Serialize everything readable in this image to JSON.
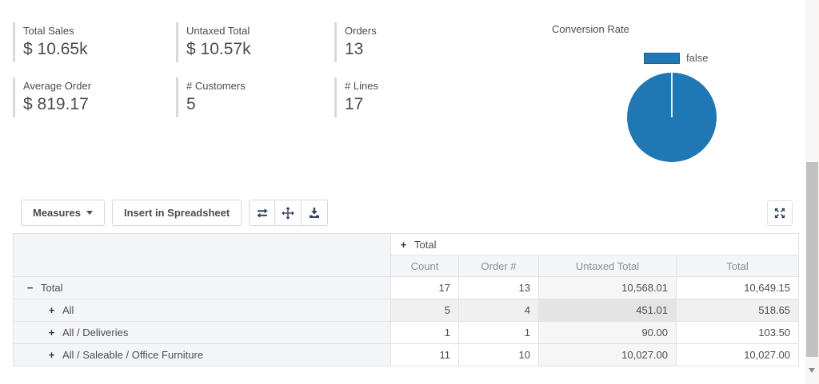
{
  "kpis": [
    {
      "label": "Total Sales",
      "value": "$ 10.65k"
    },
    {
      "label": "Untaxed Total",
      "value": "$ 10.57k"
    },
    {
      "label": "Orders",
      "value": "13"
    },
    {
      "label": "Average Order",
      "value": "$ 819.17"
    },
    {
      "label": "# Customers",
      "value": "5"
    },
    {
      "label": "# Lines",
      "value": "17"
    }
  ],
  "chart_data": {
    "type": "pie",
    "title": "Conversion Rate",
    "labels": [
      "false"
    ],
    "values": [
      100
    ],
    "colors": [
      "#1f77b4"
    ],
    "legend_position": "top",
    "legend": [
      {
        "label": "false",
        "color": "#1f77b4"
      }
    ]
  },
  "toolbar": {
    "measures_label": "Measures",
    "insert_label": "Insert in Spreadsheet",
    "icon_buttons": [
      "flip-axis-icon",
      "expand-all-icon",
      "download-icon"
    ],
    "fullscreen_icon": "fullscreen-arrows-icon"
  },
  "pivot": {
    "col_group": {
      "toggle": "+",
      "label": "Total"
    },
    "measures": [
      "Count",
      "Order #",
      "Untaxed Total",
      "Total"
    ],
    "rows": [
      {
        "toggle": "−",
        "indent": 0,
        "label": "Total",
        "values": [
          "17",
          "13",
          "10,568.01",
          "10,649.15"
        ],
        "highlight": false
      },
      {
        "toggle": "+",
        "indent": 1,
        "label": "All",
        "values": [
          "5",
          "4",
          "451.01",
          "518.65"
        ],
        "highlight": true
      },
      {
        "toggle": "+",
        "indent": 1,
        "label": "All / Deliveries",
        "values": [
          "1",
          "1",
          "90.00",
          "103.50"
        ],
        "highlight": false
      },
      {
        "toggle": "+",
        "indent": 1,
        "label": "All / Saleable / Office Furniture",
        "values": [
          "11",
          "10",
          "10,027.00",
          "10,027.00"
        ],
        "highlight": false
      }
    ]
  },
  "colors": {
    "accent_blue": "#1f77b4",
    "text_dark": "#4c4c4c",
    "header_text_gray": "#8f8f8f",
    "header_bg": "#f4f5f8",
    "row_highlight_bg": "#f0f0f0",
    "column_tint_bg": "#f6f6f6",
    "intersection_bg": "#e4e4e4",
    "border": "#e2e2e2",
    "icon_dark": "#33415c",
    "scrollbar_thumb": "#c1c1c1"
  }
}
